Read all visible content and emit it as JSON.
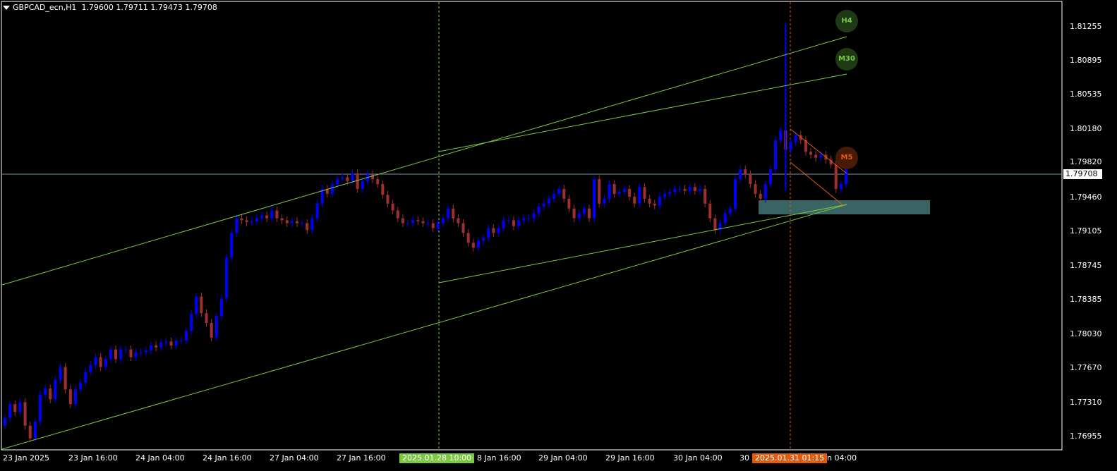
{
  "header": {
    "symbol": "GBPCAD_ecn,H1",
    "ohlc": "1.79600 1.79711 1.79473 1.79708"
  },
  "price_axis": {
    "ticks": [
      "1.81255",
      "1.80895",
      "1.80535",
      "1.80180",
      "1.79820",
      "1.79460",
      "1.79105",
      "1.78745",
      "1.78385",
      "1.78030",
      "1.77670",
      "1.77310",
      "1.76955"
    ],
    "current_price": "1.79708"
  },
  "time_axis": {
    "ticks": [
      "23 Jan 2025",
      "23 Jan 16:00",
      "24 Jan 04:00",
      "24 Jan 16:00",
      "27 Jan 04:00",
      "27 Jan 16:00",
      "8 Jan 16:00",
      "29 Jan 04:00",
      "29 Jan 16:00",
      "30 Jan 04:00",
      "30",
      "n 04:00"
    ]
  },
  "vline_labels": {
    "green": "2025.01.28 10:00",
    "orange": "2025.01.31 01:15"
  },
  "badges": {
    "h4": "H4",
    "m30": "M30",
    "m5": "M5"
  },
  "colors": {
    "bull": "#0000ff",
    "bear": "#a03030",
    "trend": "#7dc842",
    "orange": "#e05a10",
    "zone": "#3a6464",
    "grid_frame": "#ffffff",
    "price_line": "#7a96a8"
  },
  "chart_data": {
    "type": "candlestick",
    "symbol": "GBPCAD_ecn",
    "timeframe": "H1",
    "ylim": [
      1.7684,
      1.8141
    ],
    "close_series": [
      1.7716,
      1.773,
      1.7722,
      1.7732,
      1.7708,
      1.7695,
      1.7712,
      1.774,
      1.7746,
      1.7735,
      1.7755,
      1.7768,
      1.7745,
      1.773,
      1.7745,
      1.7752,
      1.7763,
      1.777,
      1.7778,
      1.7768,
      1.7776,
      1.7786,
      1.7776,
      1.7786,
      1.7786,
      1.7778,
      1.7783,
      1.7783,
      1.7785,
      1.779,
      1.7788,
      1.7793,
      1.7794,
      1.779,
      1.7795,
      1.7795,
      1.7805,
      1.7822,
      1.784,
      1.7823,
      1.7813,
      1.7798,
      1.782,
      1.7838,
      1.788,
      1.7905,
      1.792,
      1.7918,
      1.7916,
      1.7917,
      1.792,
      1.7923,
      1.792,
      1.7928,
      1.792,
      1.7918,
      1.7915,
      1.7917,
      1.7915,
      1.7915,
      1.7908,
      1.792,
      1.7935,
      1.795,
      1.7945,
      1.7955,
      1.796,
      1.7962,
      1.7958,
      1.7966,
      1.795,
      1.7958,
      1.7965,
      1.796,
      1.7955,
      1.7944,
      1.7935,
      1.7928,
      1.792,
      1.7915,
      1.7915,
      1.7918,
      1.7917,
      1.7915,
      1.7915,
      1.791,
      1.7915,
      1.792,
      1.793,
      1.792,
      1.7915,
      1.7905,
      1.7895,
      1.789,
      1.7897,
      1.79,
      1.791,
      1.7905,
      1.791,
      1.7918,
      1.7918,
      1.7912,
      1.7918,
      1.792,
      1.792,
      1.7925,
      1.7932,
      1.7935,
      1.794,
      1.7945,
      1.795,
      1.794,
      1.793,
      1.792,
      1.7925,
      1.793,
      1.792,
      1.796,
      1.7935,
      1.794,
      1.7955,
      1.7945,
      1.7947,
      1.795,
      1.7942,
      1.7935,
      1.7952,
      1.794,
      1.7935,
      1.7933,
      1.7942,
      1.7945,
      1.7947,
      1.795,
      1.795,
      1.7948,
      1.7952,
      1.7948,
      1.795,
      1.7935,
      1.792,
      1.7908,
      1.7915,
      1.7925,
      1.793,
      1.796,
      1.797,
      1.7965,
      1.7955,
      1.7945,
      1.794,
      1.7955,
      1.797,
      1.8,
      1.801,
      1.799,
      1.7998,
      1.8005,
      1.8,
      1.7988,
      1.7985,
      1.7982,
      1.7985,
      1.798,
      1.7975,
      1.795,
      1.7955,
      1.7971
    ]
  }
}
